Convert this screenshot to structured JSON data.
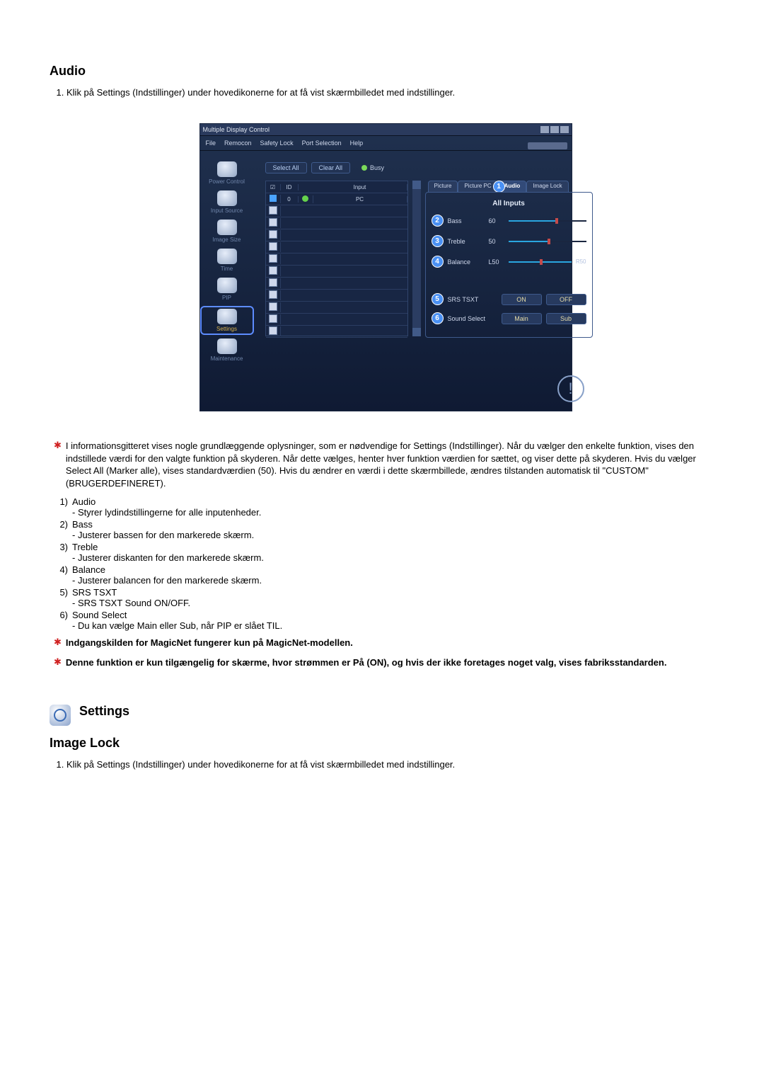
{
  "audio_heading": "Audio",
  "step1": "Klik på Settings (Indstillinger) under hovedikonerne for at få vist skærmbilledet med indstillinger.",
  "app": {
    "title": "Multiple Display Control",
    "menu": {
      "file": "File",
      "remocon": "Remocon",
      "safety": "Safety Lock",
      "port": "Port Selection",
      "help": "Help"
    },
    "sidebar": {
      "power": "Power Control",
      "input": "Input Source",
      "image": "Image Size",
      "time": "Time",
      "pip": "PIP",
      "settings": "Settings",
      "maint": "Maintenance"
    },
    "toolbar": {
      "select_all": "Select All",
      "clear_all": "Clear All",
      "busy": "Busy"
    },
    "grid": {
      "col_chk": "☑",
      "col_id": "ID",
      "col_status": " ",
      "col_input": "Input",
      "row0_id": "0",
      "row0_input": "PC"
    },
    "tabs": {
      "picture": "Picture",
      "picture_pc": "Picture PC",
      "audio": "Audio",
      "audio_num": "1",
      "image_lock": "Image Lock"
    },
    "panel": {
      "all_inputs": "All Inputs",
      "bass": {
        "num": "2",
        "label": "Bass",
        "value": "60"
      },
      "treble": {
        "num": "3",
        "label": "Treble",
        "value": "50"
      },
      "balance": {
        "num": "4",
        "label": "Balance",
        "left": "L50",
        "right": "R50"
      },
      "srs": {
        "num": "5",
        "label": "SRS TSXT",
        "on": "ON",
        "off": "OFF"
      },
      "sound": {
        "num": "6",
        "label": "Sound Select",
        "main": "Main",
        "sub": "Sub"
      }
    }
  },
  "info_paragraph": "I informationsgitteret vises nogle grundlæggende oplysninger, som er nødvendige for Settings (Indstillinger). Når du vælger den enkelte funktion, vises den indstillede værdi for den valgte funktion på skyderen. Når dette vælges, henter hver funktion værdien for sættet, og viser dette på skyderen. Hvis du vælger Select All (Marker alle), vises standardværdien (50). Hvis du ændrer en værdi i dette skærmbillede, ændres tilstanden automatisk til \"CUSTOM\" (BRUGERDEFINERET).",
  "items": {
    "i1": {
      "num": "1)",
      "title": "Audio",
      "desc": "- Styrer lydindstillingerne for alle inputenheder."
    },
    "i2": {
      "num": "2)",
      "title": "Bass",
      "desc": "- Justerer bassen for den markerede skærm."
    },
    "i3": {
      "num": "3)",
      "title": "Treble",
      "desc": "- Justerer diskanten for den markerede skærm."
    },
    "i4": {
      "num": "4)",
      "title": "Balance",
      "desc": "- Justerer balancen for den markerede skærm."
    },
    "i5": {
      "num": "5)",
      "title": "SRS TSXT",
      "desc": "- SRS TSXT Sound ON/OFF."
    },
    "i6": {
      "num": "6)",
      "title": "Sound Select",
      "desc": "- Du kan vælge Main eller Sub, når PIP er slået TIL."
    }
  },
  "note1": "Indgangskilden for MagicNet fungerer kun på MagicNet-modellen.",
  "note2": "Denne funktion er kun tilgængelig for skærme, hvor strømmen er På (ON), og hvis der ikke foretages noget valg, vises fabriksstandarden.",
  "settings_heading": "Settings",
  "imagelock_heading": "Image Lock",
  "step1b": "Klik på Settings (Indstillinger) under hovedikonerne for at få vist skærmbilledet med indstillinger."
}
